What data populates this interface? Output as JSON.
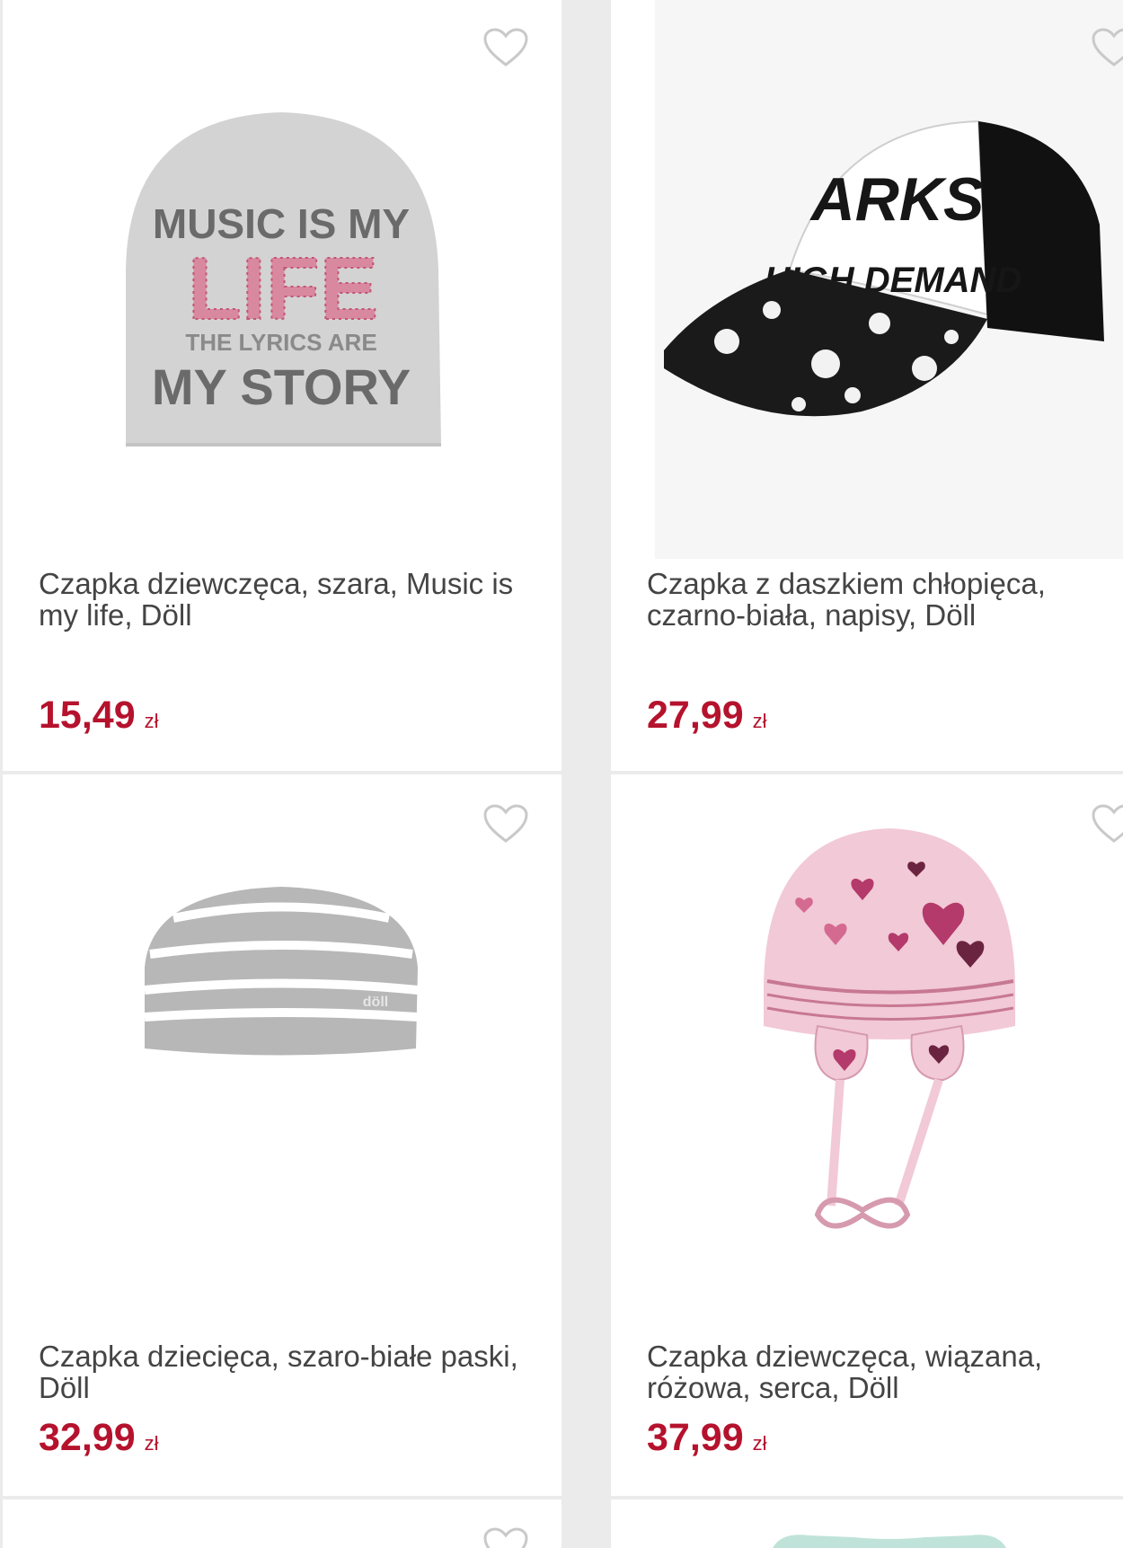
{
  "products": [
    {
      "title": "Czapka dziewczęca, szara, Music is my life, Döll",
      "price": "15,49",
      "currency": "zł",
      "print_lines": [
        "MUSIC IS MY",
        "LIFE",
        "THE LYRICS ARE",
        "MY STORY"
      ]
    },
    {
      "title": "Czapka z daszkiem chłopięca, czarno-biała, napisy, Döll",
      "price": "27,99",
      "currency": "zł",
      "print_lines": [
        "ARKS",
        "HIGH DEMAND"
      ]
    },
    {
      "title": "Czapka dziecięca, szaro-białe paski, Döll",
      "price": "32,99",
      "currency": "zł",
      "print_lines": [
        "döll"
      ]
    },
    {
      "title": "Czapka dziewczęca, wiązana, różowa, serca, Döll",
      "price": "37,99",
      "currency": "zł",
      "print_lines": []
    }
  ],
  "colors": {
    "price": "#b5122d",
    "title": "#444444",
    "background": "#ebebeb",
    "card": "#ffffff",
    "heart_outline": "#c9c9c9"
  },
  "icons": {
    "favorite": "heart-outline-icon"
  }
}
